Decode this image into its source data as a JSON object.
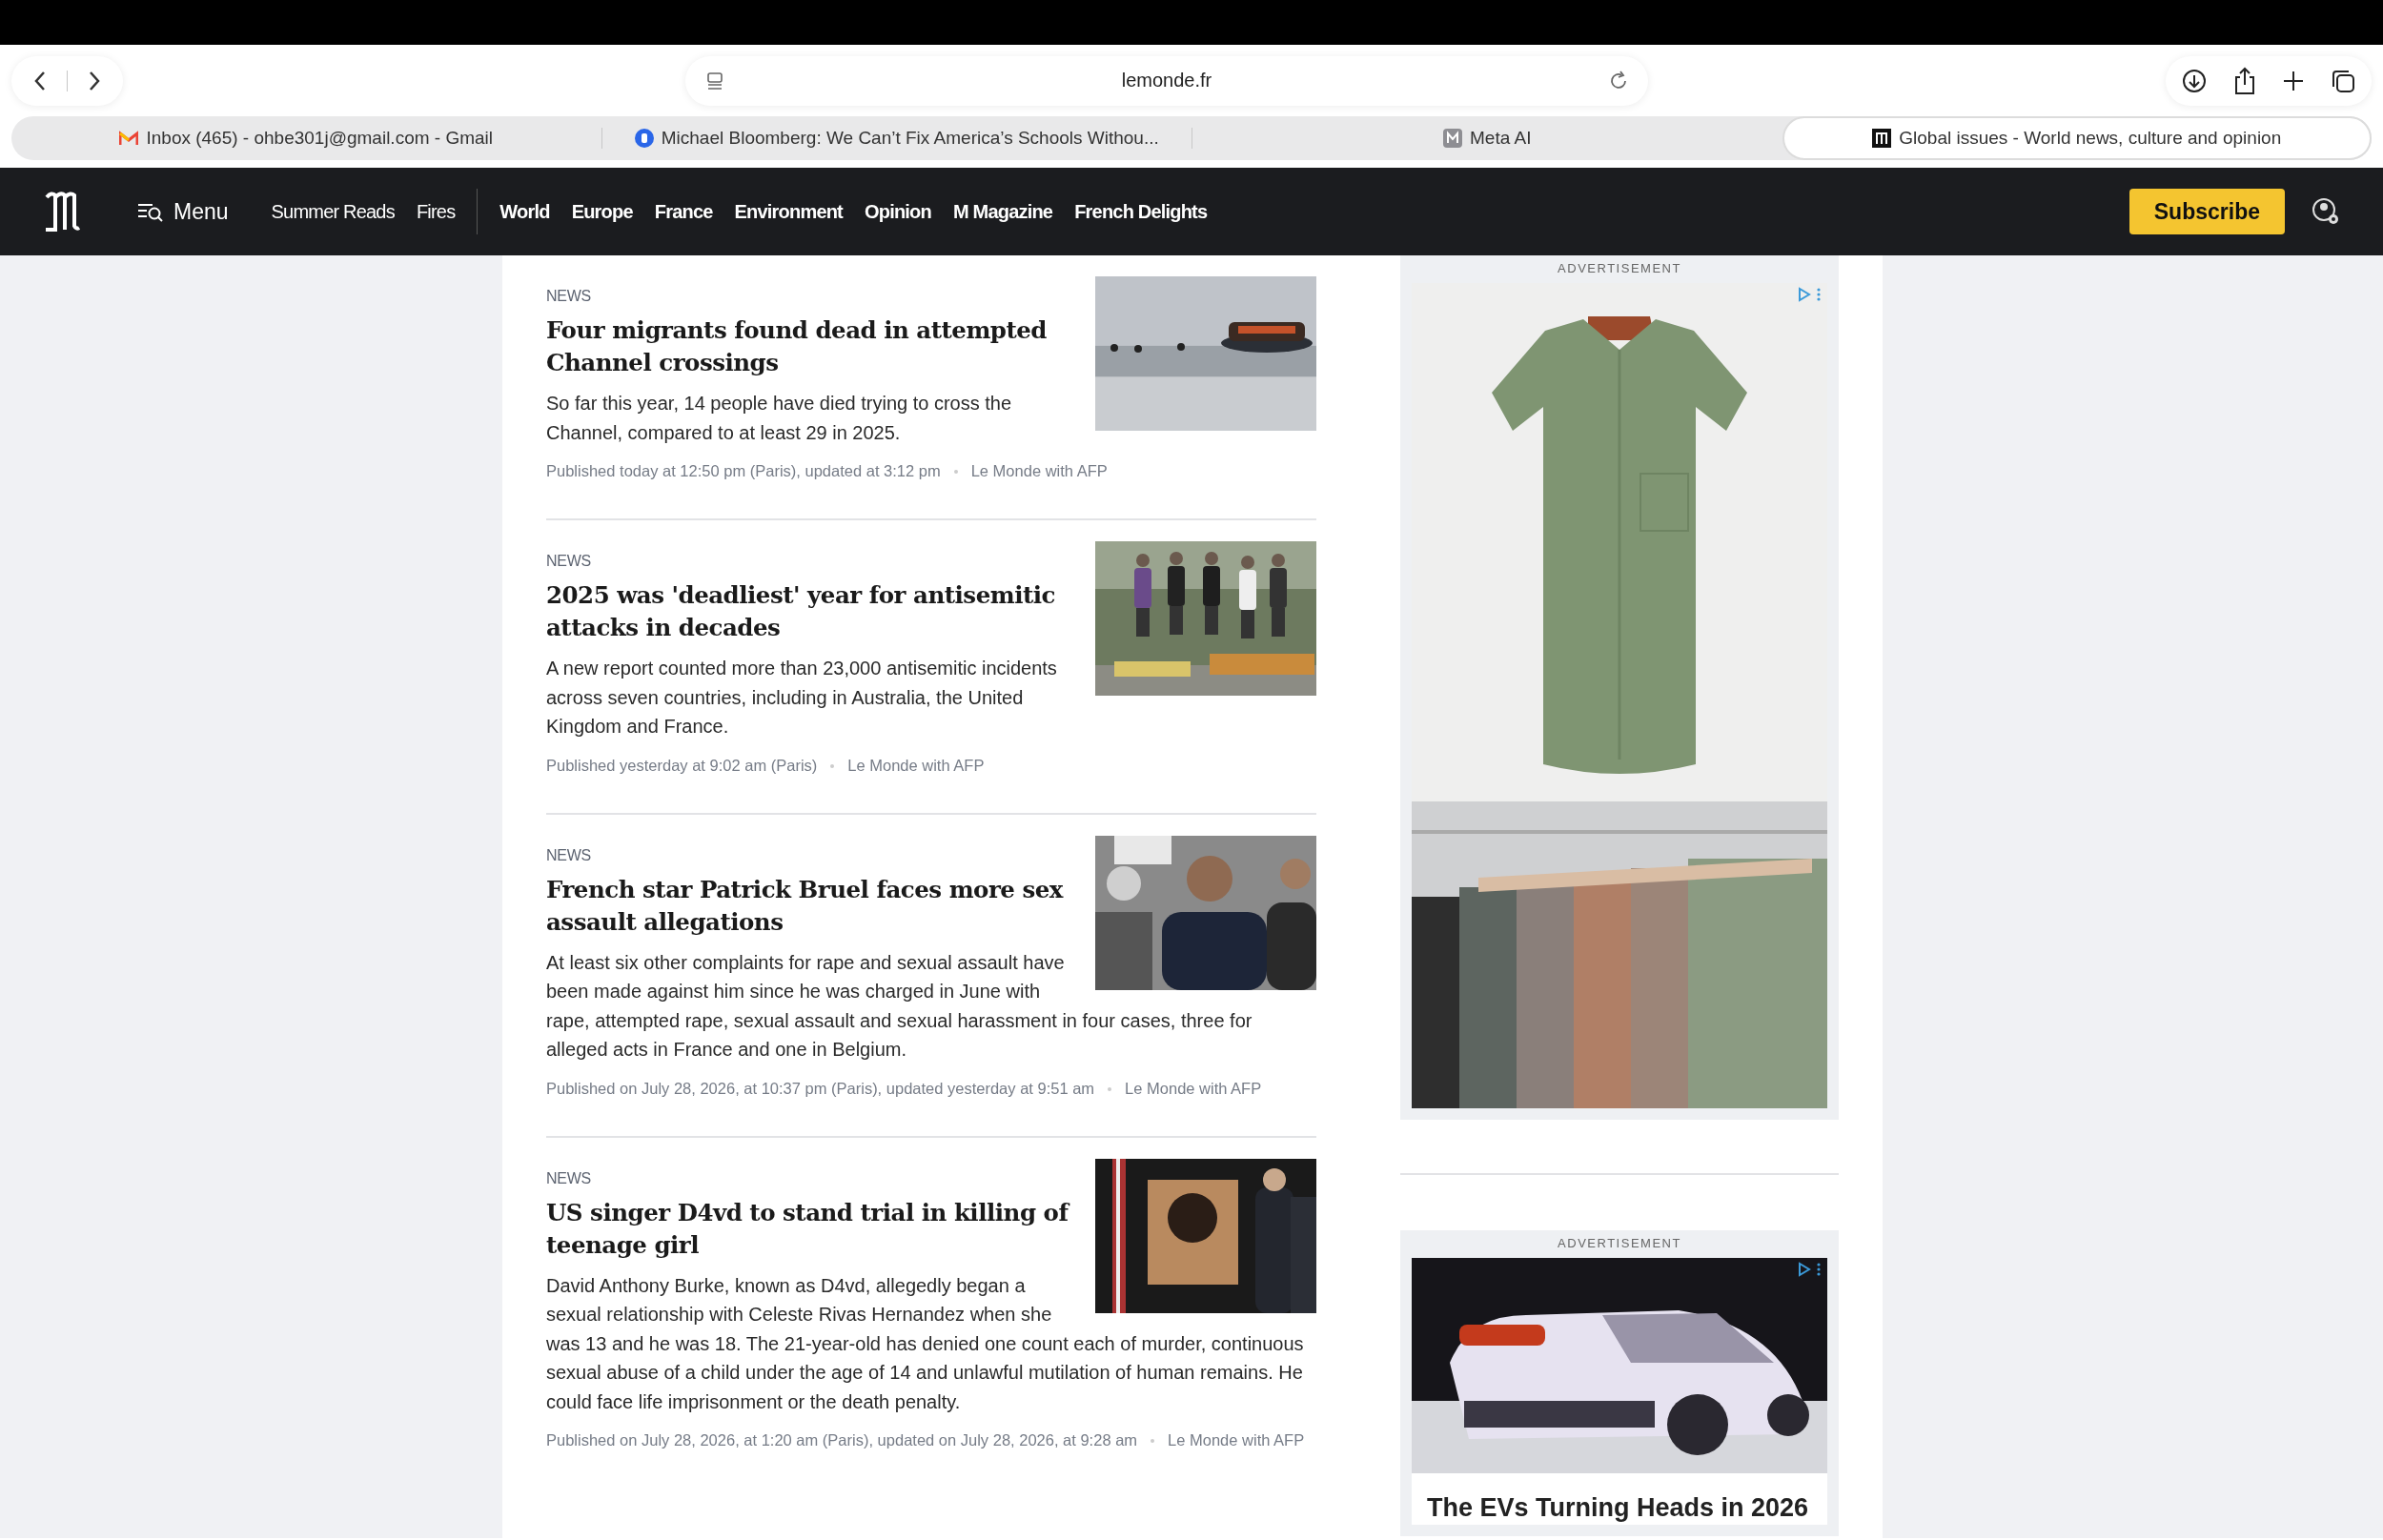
{
  "browser": {
    "address": "lemonde.fr",
    "tabs": [
      {
        "title": "Inbox (465) - ohbe301j@gmail.com - Gmail",
        "kind": "mail",
        "selected": false
      },
      {
        "title": "Michael Bloomberg: We Can’t Fix America’s Schools Withou...",
        "kind": "circle",
        "selected": false
      },
      {
        "title": "Meta AI",
        "kind": "square",
        "selected": false
      },
      {
        "title": "Global issues - World news, culture and opinion",
        "kind": "logo",
        "selected": true
      }
    ]
  },
  "site_nav": {
    "menu": "Menu",
    "featured": [
      "Summer Reads",
      "Fires"
    ],
    "sections": [
      "World",
      "Europe",
      "France",
      "Environment",
      "Opinion",
      "M Magazine",
      "French Delights"
    ],
    "subscribe": "Subscribe"
  },
  "articles": [
    {
      "tag": "NEWS",
      "title": "Four migrants found dead in attempted Channel crossings",
      "summary": "So far this year, 14 people have died trying to cross the Channel, compared to at least 29 in 2025.",
      "published": "Published today at 12:50 pm (Paris), updated at 3:12 pm",
      "source": "Le Monde with AFP"
    },
    {
      "tag": "NEWS",
      "title": "2025 was 'deadliest' year for antisemitic attacks in decades",
      "summary": "A new report counted more than 23,000 antisemitic incidents across seven countries, including in Australia, the United Kingdom and France.",
      "published": "Published yesterday at 9:02 am (Paris)",
      "source": "Le Monde with AFP"
    },
    {
      "tag": "NEWS",
      "title": "French star Patrick Bruel faces more sex assault allegations",
      "summary": "At least six other complaints for rape and sexual assault have been made against him since he was charged in June with rape, attempted rape, sexual assault and sexual harassment in four cases, three for alleged acts in France and one in Belgium.",
      "published": "Published on July 28, 2026, at 10:37 pm (Paris), updated yesterday at 9:51 am",
      "source": "Le Monde with AFP"
    },
    {
      "tag": "NEWS",
      "title": "US singer D4vd to stand trial in killing of teenage girl",
      "summary": "David Anthony Burke, known as D4vd, allegedly began a sexual relationship with Celeste Rivas Hernandez when she was 13 and he was 18. The 21-year-old has denied one count each of murder, continuous sexual abuse of a child under the age of 14 and unlawful mutilation of human remains. He could face life imprisonment or the death penalty.",
      "published": "Published on July 28, 2026, at 1:20 am (Paris), updated on July 28, 2026, at 9:28 am",
      "source": "Le Monde with AFP"
    }
  ],
  "ads": [
    {
      "label": "ADVERTISEMENT"
    },
    {
      "label": "ADVERTISEMENT",
      "headline": "The EVs Turning Heads in 2026"
    }
  ]
}
